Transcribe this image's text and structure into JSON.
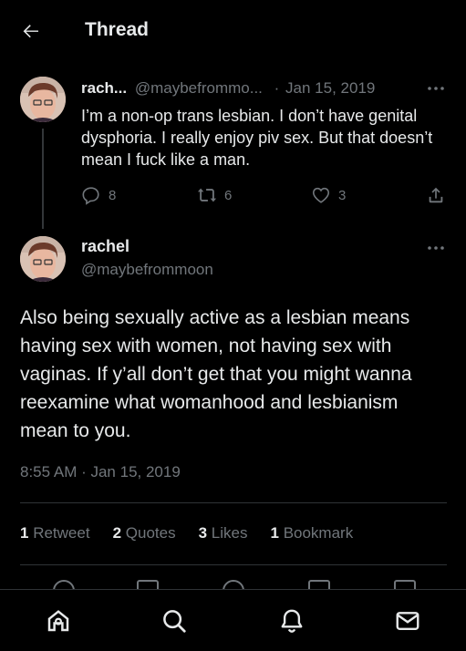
{
  "header": {
    "title": "Thread",
    "back_icon": "arrow-left-icon"
  },
  "parent_tweet": {
    "display_name": "rach...",
    "handle": "@maybefrommo...",
    "separator": "·",
    "date": "Jan 15, 2019",
    "text": "I’m a non-op trans lesbian. I don’t have genital dysphoria. I really enjoy piv sex. But that doesn’t mean I fuck like a man.",
    "replies": "8",
    "retweets": "6",
    "likes": "3"
  },
  "main_tweet": {
    "display_name": "rachel",
    "handle": "@maybefrommoon",
    "text": "Also being sexually active as a lesbian means having sex with women, not having sex with vaginas. If y’all don’t get that you might wanna reexamine what womanhood and lesbianism mean to you.",
    "timestamp": "8:55 AM · Jan 15, 2019",
    "stats": [
      {
        "count": "1",
        "label": "Retweet"
      },
      {
        "count": "2",
        "label": "Quotes"
      },
      {
        "count": "3",
        "label": "Likes"
      },
      {
        "count": "1",
        "label": "Bookmark"
      }
    ]
  },
  "colors": {
    "background": "#000000",
    "text": "#e7e9ea",
    "muted": "#71767b",
    "divider": "#2f3336"
  },
  "bottom_nav": [
    "home-icon",
    "search-icon",
    "notifications-icon",
    "messages-icon"
  ]
}
